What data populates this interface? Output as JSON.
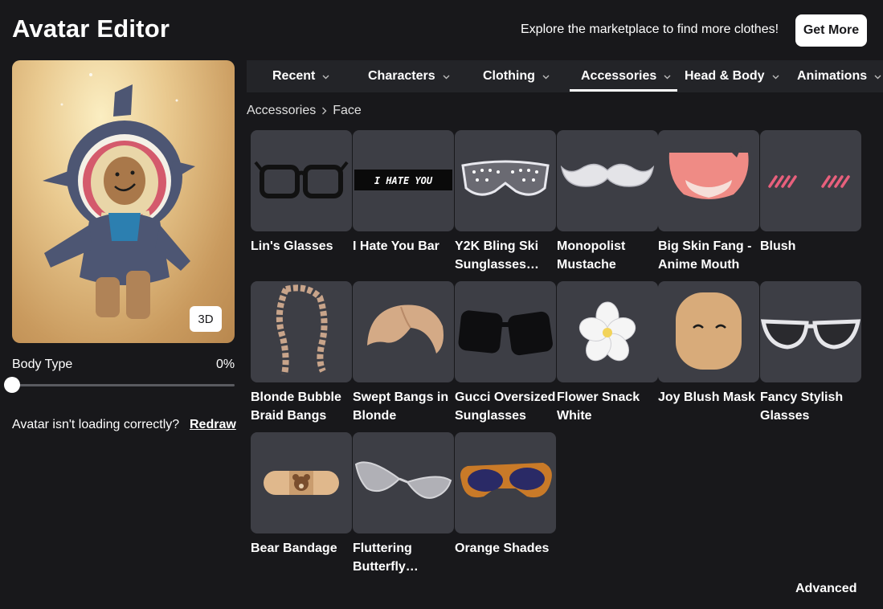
{
  "header": {
    "title": "Avatar Editor",
    "promo_text": "Explore the marketplace to find more clothes!",
    "get_more_label": "Get More"
  },
  "preview": {
    "view_toggle_label": "3D",
    "body_type_label": "Body Type",
    "body_type_value": "0%",
    "body_type_level": 0,
    "loading_message": "Avatar isn't loading correctly?",
    "redraw_label": "Redraw"
  },
  "tabs": [
    {
      "label": "Recent",
      "selected": false
    },
    {
      "label": "Characters",
      "selected": false
    },
    {
      "label": "Clothing",
      "selected": false
    },
    {
      "label": "Accessories",
      "selected": true
    },
    {
      "label": "Head & Body",
      "selected": false
    },
    {
      "label": "Animations",
      "selected": false
    }
  ],
  "breadcrumb": {
    "parent": "Accessories",
    "current": "Face"
  },
  "items": [
    {
      "name": "Lin's Glasses",
      "icon": "black-glasses-icon"
    },
    {
      "name": "I Hate You Bar",
      "icon": "text-bar-icon",
      "thumb_text": "I HATE YOU"
    },
    {
      "name": "Y2K Bling Ski Sunglasses…",
      "icon": "ski-sunglasses-icon"
    },
    {
      "name": "Monopolist Mustache",
      "icon": "mustache-icon"
    },
    {
      "name": "Big Skin Fang - Anime Mouth",
      "icon": "anime-mouth-icon"
    },
    {
      "name": "Blush",
      "icon": "blush-icon"
    },
    {
      "name": "Blonde Bubble Braid Bangs",
      "icon": "braid-bangs-icon"
    },
    {
      "name": "Swept Bangs in Blonde",
      "icon": "swept-bangs-icon"
    },
    {
      "name": "Gucci Oversized Sunglasses",
      "icon": "oversized-sunglasses-icon"
    },
    {
      "name": "Flower Snack White",
      "icon": "white-flower-icon"
    },
    {
      "name": "Joy Blush Mask",
      "icon": "smiling-mask-icon"
    },
    {
      "name": "Fancy Stylish Glasses",
      "icon": "cat-eye-glasses-icon"
    },
    {
      "name": "Bear Bandage",
      "icon": "bear-bandage-icon"
    },
    {
      "name": "Fluttering Butterfly…",
      "icon": "butterfly-glasses-icon"
    },
    {
      "name": "Orange Shades",
      "icon": "orange-shades-icon"
    }
  ],
  "footer": {
    "advanced_label": "Advanced"
  },
  "colors": {
    "background": "#18181b",
    "tab_bar": "#232428",
    "card": "#3d3e45",
    "accent_white": "#ffffff"
  }
}
